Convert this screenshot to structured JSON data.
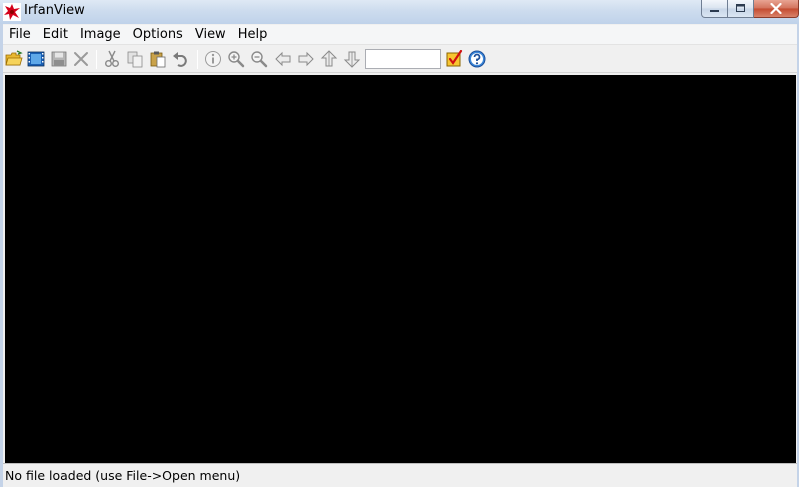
{
  "window": {
    "title": "IrfanView",
    "app_icon": "irfanview-logo-icon",
    "controls": [
      "minimize-icon",
      "maximize-icon",
      "close-icon"
    ]
  },
  "menu": {
    "items": [
      "File",
      "Edit",
      "Image",
      "Options",
      "View",
      "Help"
    ]
  },
  "toolbar": {
    "buttons": [
      "open-folder-icon",
      "slideshow-icon",
      "save-icon",
      "delete-icon",
      "cut-icon",
      "copy-icon",
      "paste-icon",
      "undo-icon",
      "info-icon",
      "zoom-in-icon",
      "zoom-out-icon",
      "previous-icon",
      "next-icon",
      "first-file-icon",
      "last-file-icon",
      "thumbnails-icon",
      "help-icon"
    ],
    "zoom_value": ""
  },
  "canvas": {
    "background": "#000000"
  },
  "status": {
    "text": "No file loaded (use File->Open menu)"
  }
}
